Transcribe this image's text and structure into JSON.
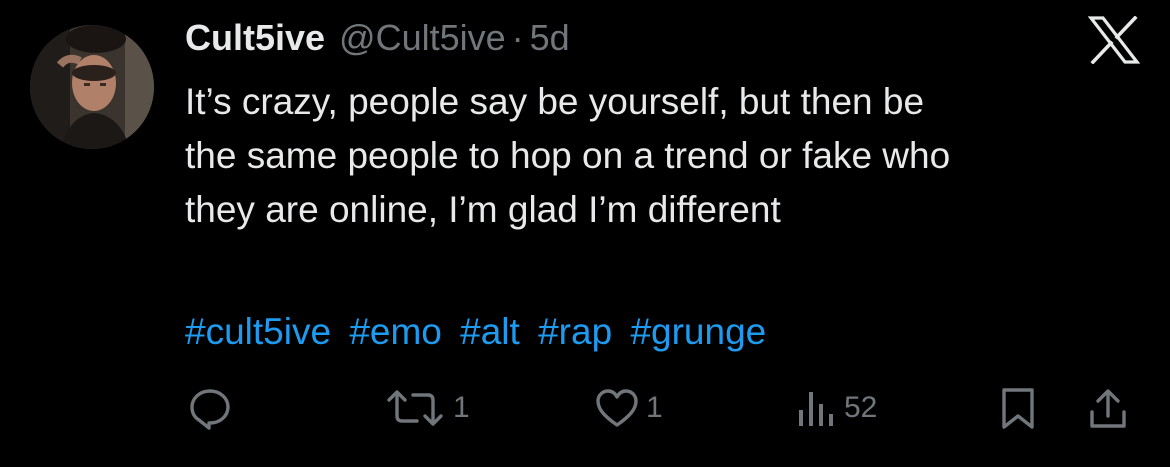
{
  "tweet": {
    "author": {
      "display_name": "Cult5ive",
      "handle": "@Cult5ive",
      "separator": "·",
      "time": "5d"
    },
    "body_lines": [
      "It’s crazy, people say be yourself, but then be",
      "the same people to hop on a trend or fake who",
      "they are online, I’m glad I’m different"
    ],
    "hashtags": [
      "#cult5ive",
      "#emo",
      "#alt",
      "#rap",
      "#grunge"
    ],
    "actions": {
      "reply": {
        "icon": "reply-icon",
        "count": ""
      },
      "retweet": {
        "icon": "retweet-icon",
        "count": "1"
      },
      "like": {
        "icon": "heart-icon",
        "count": "1"
      },
      "views": {
        "icon": "views-icon",
        "count": "52"
      },
      "bookmark": {
        "icon": "bookmark-icon"
      },
      "share": {
        "icon": "share-icon"
      }
    }
  },
  "colors": {
    "background": "#000000",
    "primary_text": "#e7e9ea",
    "secondary_text": "#71767b",
    "accent": "#1d9bf0"
  }
}
